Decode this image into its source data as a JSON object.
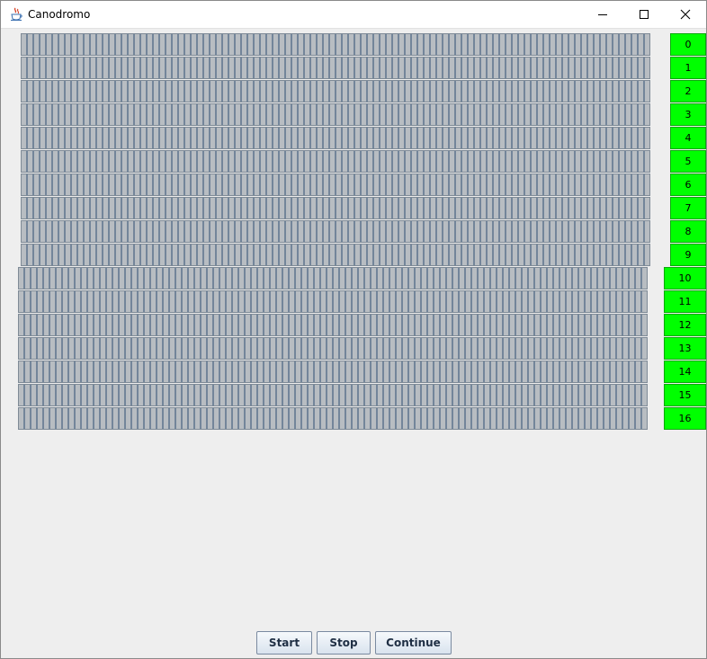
{
  "window": {
    "title": "Canodromo"
  },
  "lanes": [
    "0",
    "1",
    "2",
    "3",
    "4",
    "5",
    "6",
    "7",
    "8",
    "9",
    "10",
    "11",
    "12",
    "13",
    "14",
    "15",
    "16"
  ],
  "controls": {
    "start_label": "Start",
    "stop_label": "Stop",
    "continue_label": "Continue"
  },
  "colors": {
    "lane_box": "#00ff00",
    "track_fill": "#b8bdc2",
    "track_stripe": "#73859a"
  }
}
